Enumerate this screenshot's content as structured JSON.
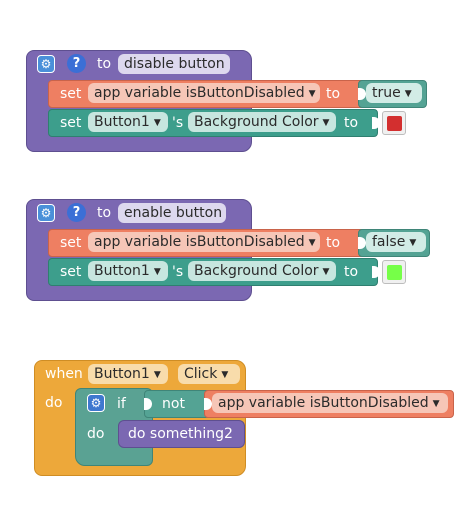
{
  "blocks": [
    {
      "kind": "procedure",
      "to_label": "to",
      "name": "disable button",
      "statements": [
        {
          "set_label": "set",
          "target": "app variable isButtonDisabled",
          "to_label": "to",
          "value": "true"
        },
        {
          "set_label": "set",
          "component": "Button1",
          "possessive": "'s",
          "property": "Background Color",
          "to_label": "to",
          "color": "#d32f2f"
        }
      ]
    },
    {
      "kind": "procedure",
      "to_label": "to",
      "name": "enable button",
      "statements": [
        {
          "set_label": "set",
          "target": "app variable isButtonDisabled",
          "to_label": "to",
          "value": "false"
        },
        {
          "set_label": "set",
          "component": "Button1",
          "possessive": "'s",
          "property": "Background Color",
          "to_label": "to",
          "color": "#76ff48"
        }
      ]
    },
    {
      "kind": "event",
      "when_label": "when",
      "component": "Button1",
      "event": "Click",
      "do_label": "do",
      "if_label": "if",
      "not_label": "not",
      "condition": "app variable isButtonDisabled",
      "inner_do_label": "do",
      "call": "do something2"
    }
  ],
  "icons": {
    "settings": "gear-icon",
    "help": "help-icon",
    "dropdown": "chevron-down-icon"
  },
  "colors": {
    "procedure": "#7b68b2",
    "set_app_variable": "#ee7f62",
    "set_component": "#3d9e8c",
    "logic": "#54a394",
    "event": "#eda83a",
    "help": "#3b6fd6"
  }
}
